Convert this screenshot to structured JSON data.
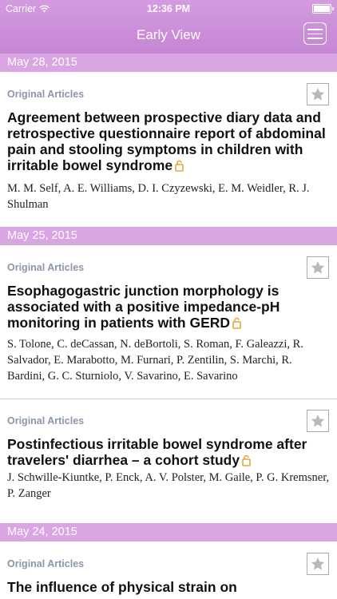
{
  "status_bar": {
    "carrier": "Carrier",
    "time": "12:36 PM"
  },
  "nav": {
    "title": "Early View"
  },
  "groups": [
    {
      "date": "May 28, 2015"
    },
    {
      "date": "May 25, 2015"
    },
    {
      "date": "May 24, 2015"
    }
  ],
  "articles": [
    {
      "section": "Original Articles",
      "title": "Agreement between prospective diary data and retrospective questionnaire report of abdominal pain and stooling symptoms in children with irritable bowel syndrome",
      "authors": "M. M. Self, A. E. Williams, D. I. Czyzewski, E. M. Weidler, R. J. Shulman"
    },
    {
      "section": "Original Articles",
      "title": "Esophagogastric junction morphology is associated with a positive impedance-pH monitoring in patients with GERD",
      "authors": "S. Tolone, C. deCassan, N. deBortoli, S. Roman, F. Galeazzi, R. Salvador, E. Marabotto, M. Furnari, P. Zentilin, S. Marchi, R. Bardini, G. C. Sturniolo, V. Savarino, E. Savarino"
    },
    {
      "section": "Original Articles",
      "title": "Postinfectious irritable bowel syndrome after travelers' diarrhea – a cohort study",
      "authors": "J. Schwille-Kiuntke, P. Enck, A. V. Polster, M. Gaile, P. G. Kremsner, P. Zanger"
    },
    {
      "section": "Original Articles",
      "title": "The influence of physical strain on",
      "authors": ""
    }
  ],
  "colors": {
    "nav_bar": "#c98bd7",
    "date_header": "#d9a5e2",
    "section_label": "#8b96ab",
    "open_access_lock": "#e8a33a"
  },
  "icons": {
    "menu": "hamburger-menu-icon",
    "favorite": "star-icon",
    "open_access": "lock-icon",
    "wifi": "wifi-icon",
    "battery": "battery-icon"
  }
}
